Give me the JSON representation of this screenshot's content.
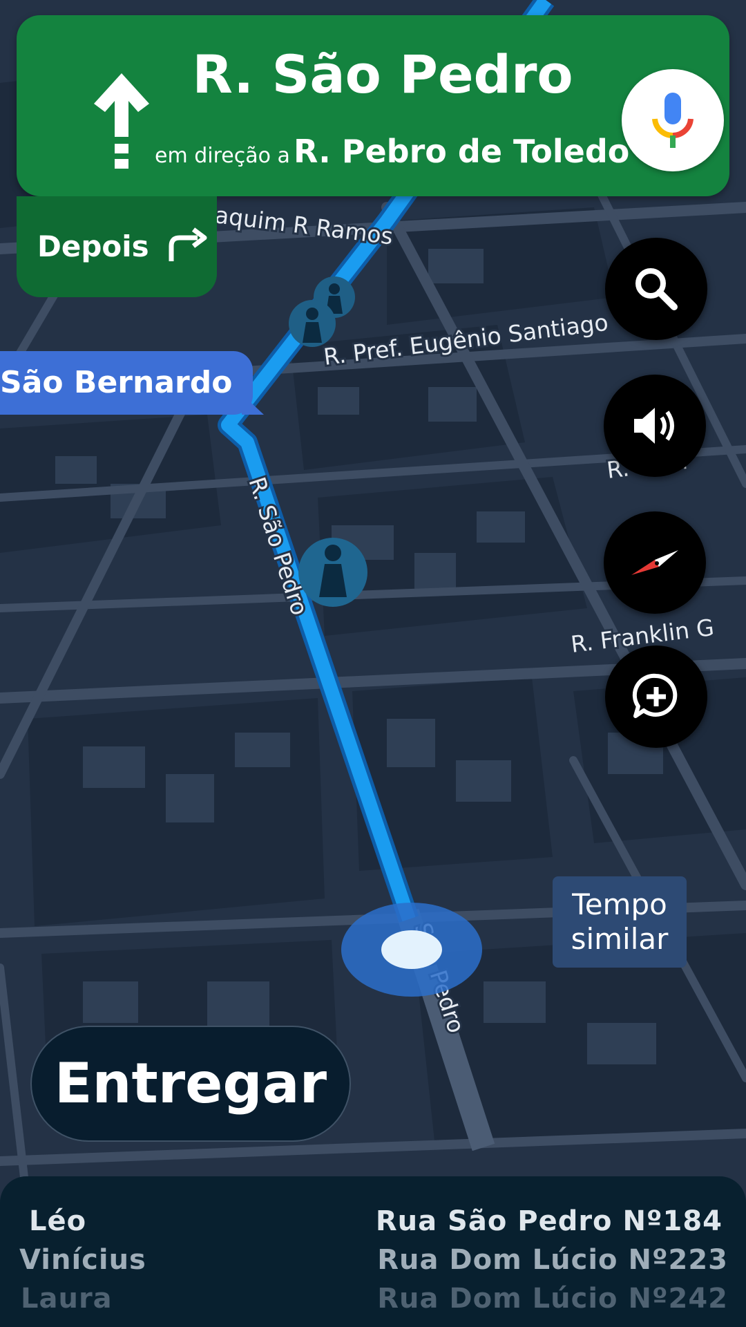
{
  "navigation": {
    "street": "R. São Pedro",
    "toward_prefix": "em direção a",
    "toward_street": "R. Pebro de Toledo",
    "then_label": "Depois"
  },
  "map_labels": {
    "joaquim": "aquim R Ramos",
    "eugenio": "R. Pref. Eugênio Santiago",
    "sao_pedro_upper": "R. São Pedro",
    "sao_pedro_lower": "São Pedro",
    "franklin": "R. Franklin G",
    "edge_right": "R. s For"
  },
  "street_chip": "São Bernardo",
  "time_callout": {
    "line1": "Tempo",
    "line2": "similar"
  },
  "deliver_button": "Entregar",
  "deliveries": [
    {
      "name": "Léo",
      "address": "Rua São Pedro Nº184"
    },
    {
      "name": "Vinícius",
      "address": "Rua Dom Lúcio Nº223"
    },
    {
      "name": "Laura",
      "address": "Rua Dom Lúcio Nº242"
    }
  ],
  "colors": {
    "banner": "#14833f",
    "then_box": "#0f6b33",
    "route": "#1a9cf0",
    "map_background": "#243246",
    "street_chip": "#3d6fd6",
    "bottom_sheet": "#08202f"
  },
  "icons": {
    "maneuver": "straight-arrow-icon",
    "then": "turn-right-icon",
    "mic": "mic-icon",
    "search": "search-icon",
    "sound": "speaker-icon",
    "compass": "compass-icon",
    "report": "add-report-icon",
    "poi": "pedestrian-icon"
  }
}
